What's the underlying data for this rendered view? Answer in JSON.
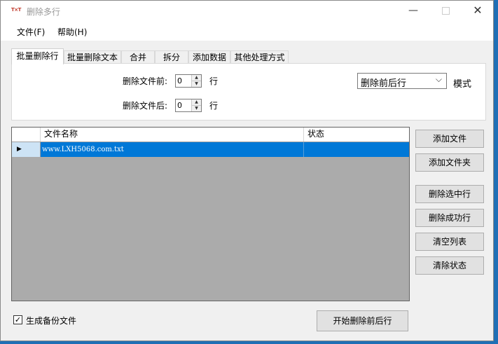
{
  "window": {
    "title": "删除多行",
    "app_icon_text": "T×T"
  },
  "menu": [
    "文件(F)",
    "帮助(H)"
  ],
  "tabs": [
    "批量删除行",
    "批量删除文本",
    "合并",
    "拆分",
    "添加数据",
    "其他处理方式"
  ],
  "tab_panel": {
    "before_label": "删除文件前:",
    "before_value": "0",
    "before_unit": "行",
    "after_label": "删除文件后:",
    "after_value": "0",
    "after_unit": "行",
    "mode_value": "删除前后行",
    "mode_label": "模式"
  },
  "grid": {
    "columns": [
      "文件名称",
      "状态"
    ],
    "rows": [
      {
        "filename": "www.LXH5068.com.txt",
        "status": ""
      }
    ]
  },
  "side_buttons": [
    "添加文件",
    "添加文件夹",
    "删除选中行",
    "删除成功行",
    "清空列表",
    "清除状态"
  ],
  "backup": {
    "label": "生成备份文件",
    "checked": true
  },
  "start_button": "开始删除前后行"
}
